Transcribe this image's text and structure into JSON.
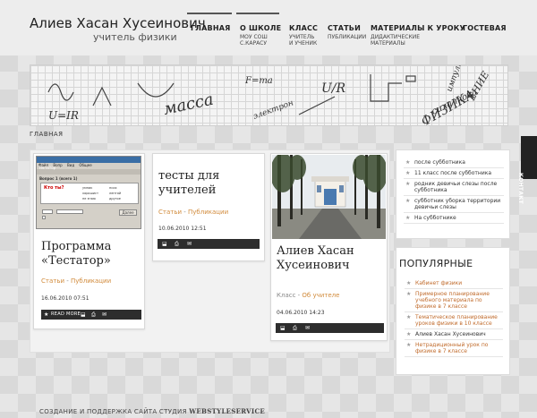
{
  "site": {
    "title": "Алиев Хасан Хусеинович",
    "subtitle": "учитель физики"
  },
  "nav": [
    {
      "label": "ГЛАВНАЯ",
      "sub": ""
    },
    {
      "label": "О ШКОЛЕ",
      "sub": "МОУ СОШ\nС.КАРАСУ"
    },
    {
      "label": "КЛАСС",
      "sub": "УЧИТЕЛЬ\nИ УЧЕНИК"
    },
    {
      "label": "СТАТЬИ",
      "sub": "ПУБЛИКАЦИИ"
    },
    {
      "label": "МАТЕРИАЛЫ К УРОКУ",
      "sub": "ДИДАКТИЧЕСКИЕ\nМАТЕРИАЛЫ"
    },
    {
      "label": "ГОСТЕВАЯ",
      "sub": ""
    }
  ],
  "banner": {
    "words": [
      "масса",
      "U/R",
      "сила тока",
      "ФИЗИКА",
      "импульс",
      "F=ma",
      "U=IR",
      "электрон",
      "ЕНИЕ"
    ]
  },
  "breadcrumb": "ГЛАВНАЯ",
  "cards": [
    {
      "title": "Программа «Тестатор»",
      "cat": "Статьи",
      "cat_link": "Публикации",
      "date": "16.06.2010 07:51",
      "readmore": "READ MORE",
      "screenshot": {
        "window_title": "Тестатор",
        "menu": [
          "Файл",
          "Вопр",
          "Вид",
          "Общее"
        ],
        "question": "Вопрос 1 (всего 1)",
        "prompt": "Кто ты?",
        "options": [
          "умник",
          "псих",
          "хорошист",
          "лентяй",
          "не знаю",
          "другое"
        ],
        "button": "Далее"
      }
    },
    {
      "title": "тесты для учителей",
      "cat": "Статьи",
      "cat_link": "Публикации",
      "date": "10.06.2010 12:51"
    },
    {
      "title": "Алиев Хасан Хусеинович",
      "cat": "Класс",
      "cat_link": "Об учителе",
      "date": "04.06.2010 14:23"
    }
  ],
  "recent": [
    "после субботника",
    "11 класс после субботника",
    "родник девичьи слезы после субботника",
    "субботник уборка территории девичьи слезы",
    "На субботнике"
  ],
  "popular": {
    "title": "ПОПУЛЯРНЫЕ",
    "items": [
      "Кабинет физики",
      "Примерное планирование учебного материала по физике в 7 классе",
      "Тематическое планирование уроков физики в 10 классе",
      "Алиев Хасан Хусеинович",
      "Нетрадиционный урок по физике в 7 классе"
    ]
  },
  "contact": "КОНТАКТ",
  "footer": {
    "text": "СОЗДАНИЕ И ПОДДЕРЖКА САЙТА СТУДИЯ",
    "studio": "WEBSTYLESERVICE"
  },
  "colors": {
    "accent": "#d18a3a",
    "dark_toolbar": "#2d2d2d",
    "link": "#c06a2a"
  }
}
